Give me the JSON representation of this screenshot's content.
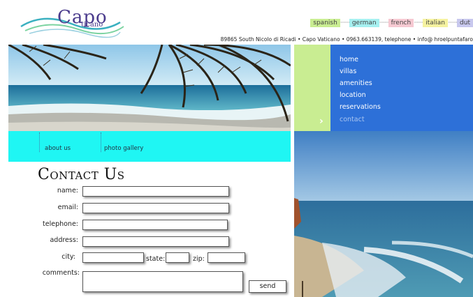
{
  "brand": {
    "name": "Capo",
    "sub": "ticano"
  },
  "languages": [
    {
      "label": "spanish",
      "color": "#c9ed92"
    },
    {
      "label": "german",
      "color": "#a6f0f0"
    },
    {
      "label": "french",
      "color": "#f6c9d2"
    },
    {
      "label": "italian",
      "color": "#f5f2a0"
    },
    {
      "label": "dut",
      "color": "#c8c8ee"
    }
  ],
  "address_line": "89865 South Nicolo di Ricadi • Capo Vaticano • 0963.663139, telephone • info@ hroelpuntafaro",
  "subnav": {
    "about": "about us",
    "gallery": "photo gallery"
  },
  "menu": [
    {
      "label": "home"
    },
    {
      "label": "villas"
    },
    {
      "label": "amenities"
    },
    {
      "label": "location"
    },
    {
      "label": "reservations"
    },
    {
      "label": "contact",
      "active": true
    }
  ],
  "form": {
    "title": "Contact Us",
    "name_label": "name:",
    "email_label": "email:",
    "telephone_label": "telephone:",
    "address_label": "address:",
    "city_label": "city:",
    "state_label": "state:",
    "zip_label": "zip:",
    "comments_label": "comments:",
    "send_label": "send"
  },
  "colors": {
    "cyan": "#1ff6f3",
    "menu_blue": "#2d70d8",
    "green": "#c9ed92"
  }
}
